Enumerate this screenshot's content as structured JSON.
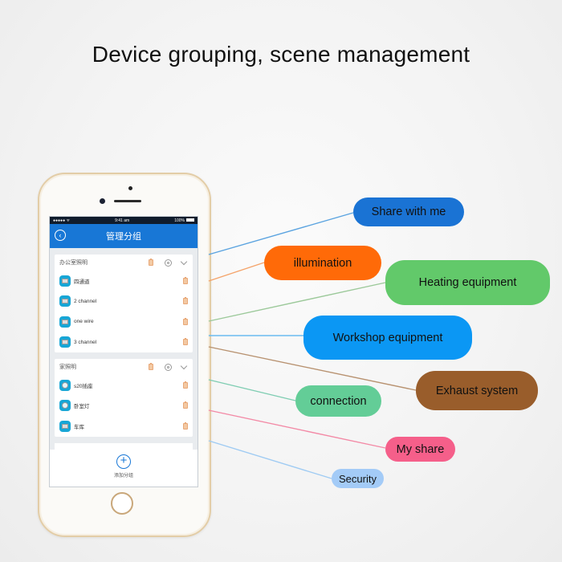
{
  "title": "Device grouping, scene management",
  "phone": {
    "status_bar": {
      "signal": "●●●●● ᯤ",
      "time": "9:41 am",
      "battery": "100%"
    },
    "nav": {
      "back_icon": "chevron-left",
      "title": "管理分组"
    },
    "groups": [
      {
        "name": "办公室照明",
        "devices": [
          {
            "name": "四通道",
            "icon": "switch-4"
          },
          {
            "name": "2 channel",
            "icon": "switch-2"
          },
          {
            "name": "one wire",
            "icon": "switch-1"
          },
          {
            "name": "3 channel",
            "icon": "switch-3"
          }
        ]
      },
      {
        "name": "家照明",
        "devices": [
          {
            "name": "s20插座",
            "icon": "socket"
          },
          {
            "name": "卧室灯",
            "icon": "socket"
          },
          {
            "name": "车库",
            "icon": "switch-4"
          }
        ]
      }
    ],
    "add_group": {
      "icon": "plus",
      "label": "添加分组"
    }
  },
  "categories": [
    {
      "label": "Share with me",
      "color": "#1a73d4",
      "line": "#5aa3e0"
    },
    {
      "label": "illumination",
      "color": "#ff6a08",
      "line": "#f4a36a"
    },
    {
      "label": "Heating equipment",
      "color": "#62c96a",
      "line": "#9cc99a"
    },
    {
      "label": "Workshop equipment",
      "color": "#0b97f4",
      "line": "#6bbcf0"
    },
    {
      "label": "Exhaust system",
      "color": "#995d2b",
      "line": "#b89270"
    },
    {
      "label": "connection",
      "color": "#63cd97",
      "line": "#7fcdb2"
    },
    {
      "label": "My share",
      "color": "#f55f8a",
      "line": "#f38aa6"
    },
    {
      "label": "Security",
      "color": "#a3cbf7",
      "line": "#9fcbf3"
    }
  ]
}
